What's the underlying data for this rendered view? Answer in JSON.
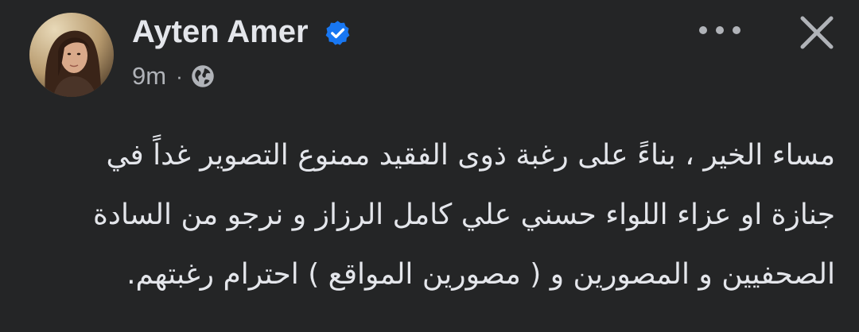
{
  "post": {
    "author": {
      "name": "Ayten Amer",
      "verified": true,
      "avatar_icon": "profile-photo"
    },
    "meta": {
      "time": "9m",
      "separator": "·",
      "audience_icon": "globe-icon"
    },
    "actions": {
      "more_icon": "more-dots-icon",
      "close_icon": "close-icon"
    },
    "body_lines": [
      "مساء الخير ، بناءً على رغبة ذوى الفقيد ممنوع التصوير غداً في",
      "جنازة او عزاء اللواء حسني علي كامل الرزاز و نرجو من السادة",
      "الصحفيين و المصورين و ( مصورين المواقع ) احترام رغبتهم."
    ]
  },
  "colors": {
    "background": "#242526",
    "primary_text": "#e4e6eb",
    "secondary_text": "#b0b3b8",
    "verified_badge": "#1877f2"
  }
}
